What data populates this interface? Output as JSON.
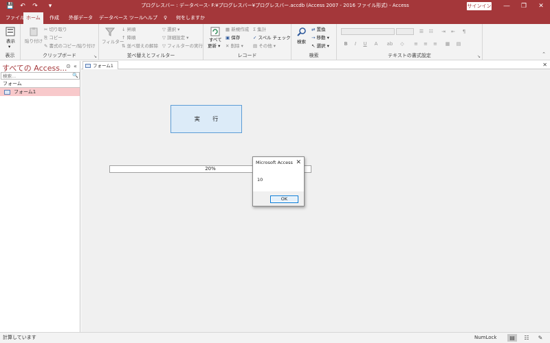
{
  "window": {
    "title": "プログレスバー : データベース- F:¥プログレスバー¥プログレスバー.accdb (Access 2007 - 2016 ファイル形式) - Access",
    "signin_label": "サインイン",
    "minimize_icon": "―",
    "restore_icon": "❐",
    "close_icon": "✕"
  },
  "quick_access": {
    "save_icon": "💾",
    "undo_icon": "↶",
    "redo_icon": "↷",
    "customize_icon": "▾"
  },
  "tabs": [
    {
      "label": "ファイル"
    },
    {
      "label": "ホーム",
      "active": true
    },
    {
      "label": "作成"
    },
    {
      "label": "外部データ"
    },
    {
      "label": "データベース ツール"
    },
    {
      "label": "ヘルプ"
    },
    {
      "label": "何をしますか"
    }
  ],
  "tell_me_icon": "♀",
  "ribbon": {
    "views": {
      "group": "表示",
      "view_label": "表示",
      "view_caret": "▾"
    },
    "clipboard": {
      "group": "クリップボード",
      "paste": "貼り付け",
      "cut": "切り取り",
      "copy": "コピー",
      "format_painter": "書式のコピー/貼り付け"
    },
    "sort_filter": {
      "group": "並べ替えとフィルター",
      "filter": "フィルター",
      "ascending": "昇順",
      "descending": "降順",
      "remove_sort": "並べ替えの解除",
      "selection": "選択 ▾",
      "advanced": "詳細設定 ▾",
      "toggle_filter": "フィルターの実行"
    },
    "records": {
      "group": "レコード",
      "refresh": "すべて",
      "refresh2": "更新 ▾",
      "new": "新規作成",
      "save": "保存",
      "delete": "削除 ▾",
      "totals": "集計",
      "spelling": "スペル チェック",
      "more": "その他 ▾"
    },
    "find": {
      "group": "検索",
      "find": "検索",
      "replace": "置換",
      "goto": "移動 ▾",
      "select": "選択 ▾"
    },
    "text_format": {
      "group": "テキストの書式設定",
      "bold": "B",
      "italic": "I",
      "underline": "U",
      "font_color": "A",
      "highlight": "ab",
      "fill": "◇"
    }
  },
  "nav_pane": {
    "title": "すべての Access...",
    "search_placeholder": "検索...",
    "search_icon": "🔍",
    "group_header": "フォーム",
    "items": [
      {
        "label": "フォーム1"
      }
    ],
    "collapse_icon": "«",
    "menu_icon": "⊙"
  },
  "document": {
    "tab_label": "フォーム1",
    "close_icon": "✕"
  },
  "form": {
    "run_button": "実 行",
    "progress": {
      "value": 0.2,
      "label": "20%"
    }
  },
  "dialog": {
    "title": "Microsoft Access",
    "message": "10",
    "ok_label": "OK",
    "close_icon": "✕"
  },
  "status": {
    "left_text": "計算しています",
    "numlock": "NumLock"
  }
}
